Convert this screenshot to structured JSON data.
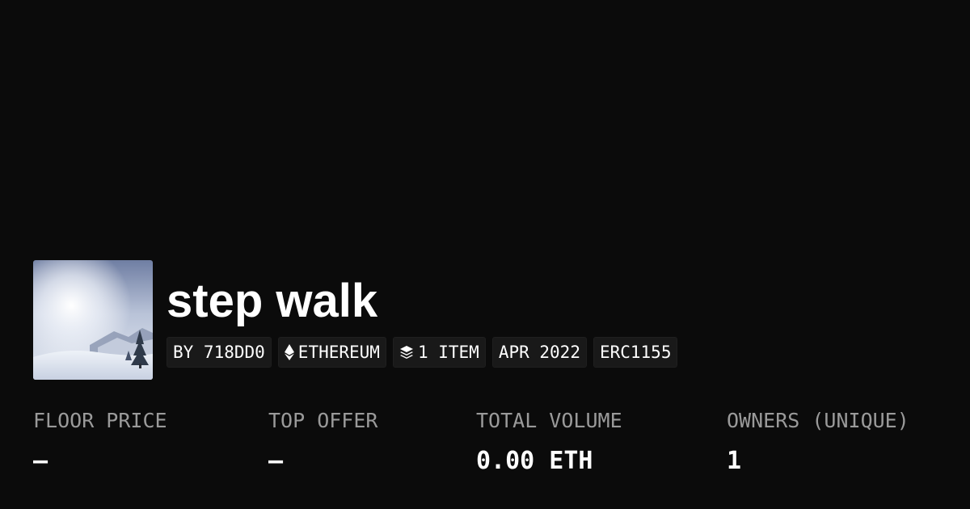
{
  "collection": {
    "title": "step walk",
    "avatar_icon": "collection-avatar-snowy-landscape"
  },
  "badges": {
    "creator": "BY 718DD0",
    "chain": "ETHEREUM",
    "chain_icon": "ethereum-icon",
    "items": "1 ITEM",
    "items_icon": "layers-icon",
    "date": "APR 2022",
    "standard": "ERC1155"
  },
  "stats": {
    "floor_price": {
      "label": "FLOOR PRICE",
      "value": "—"
    },
    "top_offer": {
      "label": "TOP OFFER",
      "value": "—"
    },
    "total_volume": {
      "label": "TOTAL VOLUME",
      "value": "0.00 ETH"
    },
    "owners": {
      "label": "OWNERS (UNIQUE)",
      "value": "1"
    }
  },
  "colors": {
    "background": "#0b0b0b",
    "badge_background": "#191919",
    "label_text": "#9a9a9a",
    "value_text": "#ffffff"
  }
}
